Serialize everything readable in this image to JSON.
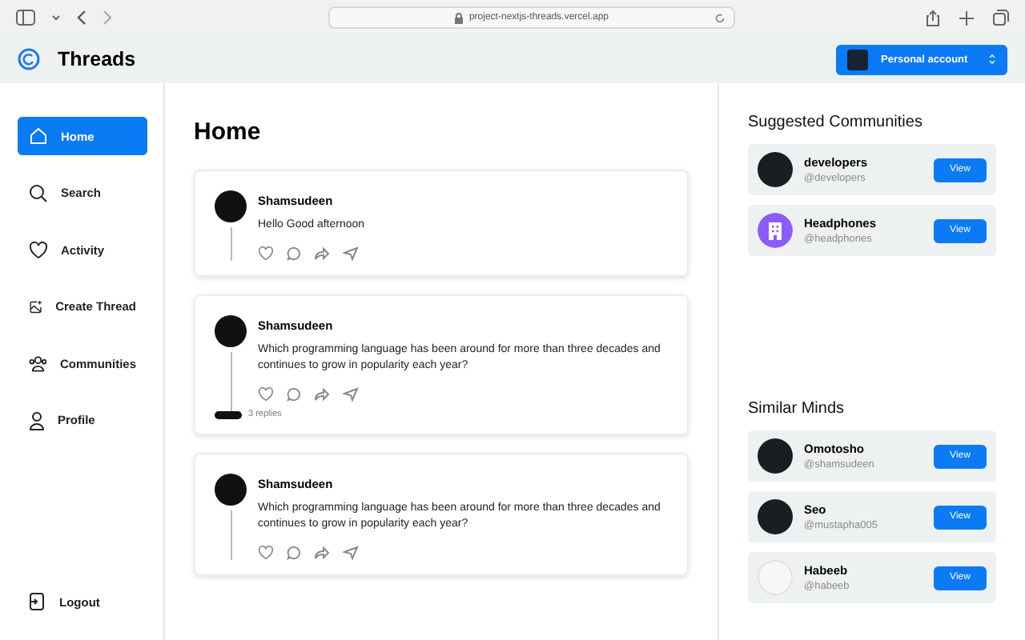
{
  "browser": {
    "url": "project-nextjs-threads.vercel.app"
  },
  "topbar": {
    "app_name": "Threads",
    "account": "Personal account"
  },
  "sidebar": {
    "items": [
      {
        "label": "Home",
        "selected": true
      },
      {
        "label": "Search",
        "selected": false
      },
      {
        "label": "Activity",
        "selected": false
      },
      {
        "label": "Create Thread",
        "selected": false
      },
      {
        "label": "Communities",
        "selected": false
      },
      {
        "label": "Profile",
        "selected": false
      }
    ],
    "logout": "Logout"
  },
  "main": {
    "title": "Home",
    "posts": [
      {
        "author": "Shamsudeen",
        "text": "Hello Good afternoon"
      },
      {
        "author": "Shamsudeen",
        "text": "Which programming language has been around for more than three decades and continues to grow in popularity each year?",
        "replies": "3 replies"
      },
      {
        "author": "Shamsudeen",
        "text": "Which programming language has been around for more than three decades and continues to grow in popularity each year?"
      }
    ]
  },
  "right_panel": {
    "suggested_communities": {
      "title": "Suggested Communities",
      "items": [
        {
          "name": "developers",
          "handle": "@developers",
          "kind": "photo",
          "button": "View"
        },
        {
          "name": "Headphones",
          "handle": "@headphones",
          "kind": "icon",
          "button": "View"
        }
      ]
    },
    "similar_minds": {
      "title": "Similar Minds",
      "items": [
        {
          "name": "Omotosho",
          "handle": "@shamsudeen",
          "kind": "photo",
          "button": "View"
        },
        {
          "name": "Seo",
          "handle": "@mustapha005",
          "kind": "photo",
          "button": "View"
        },
        {
          "name": "Habeeb",
          "handle": "@habeeb",
          "kind": "blank",
          "button": "View"
        }
      ]
    }
  }
}
